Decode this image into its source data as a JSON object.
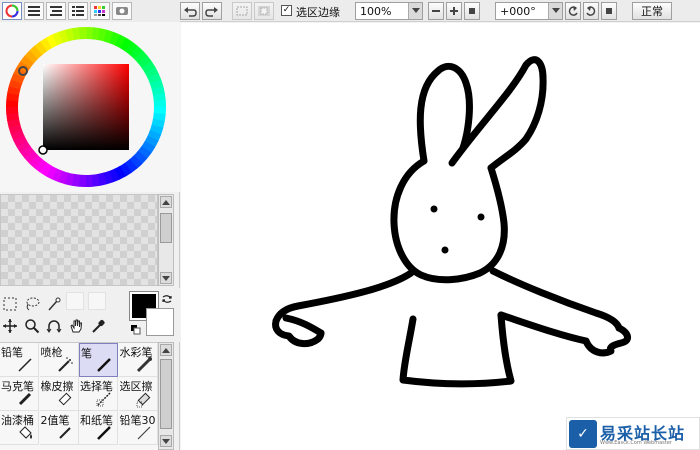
{
  "toolbar": {
    "selection_edge_label": "选区边缘",
    "selection_edge_checked": "✓",
    "zoom_value": "100%",
    "rotation_value": "+000°",
    "mode_label": "正常"
  },
  "brushes": [
    {
      "label": "铅笔",
      "icon": "pencil-icon"
    },
    {
      "label": "喷枪",
      "icon": "airbrush-icon"
    },
    {
      "label": "笔",
      "icon": "pen-icon",
      "selected": true
    },
    {
      "label": "水彩笔",
      "icon": "watercolor-icon"
    },
    {
      "label": "马克笔",
      "icon": "marker-icon"
    },
    {
      "label": "橡皮擦",
      "icon": "eraser-icon"
    },
    {
      "label": "选择笔",
      "icon": "select-pen-icon"
    },
    {
      "label": "选区擦",
      "icon": "select-eraser-icon"
    },
    {
      "label": "油漆桶",
      "icon": "bucket-icon"
    },
    {
      "label": "2值笔",
      "icon": "binary-pen-icon"
    },
    {
      "label": "和纸笔",
      "icon": "washi-pen-icon"
    },
    {
      "label": "铅笔30",
      "icon": "pencil30-icon"
    }
  ],
  "colors": {
    "foreground": "#000000",
    "background": "#ffffff",
    "wheel_marker": "#888888",
    "brand_blue": "#1b5fa8"
  },
  "watermark": {
    "logo": "✓",
    "title": "易采站长站",
    "subtitle": "Www.Easck.Com Webmaster"
  }
}
